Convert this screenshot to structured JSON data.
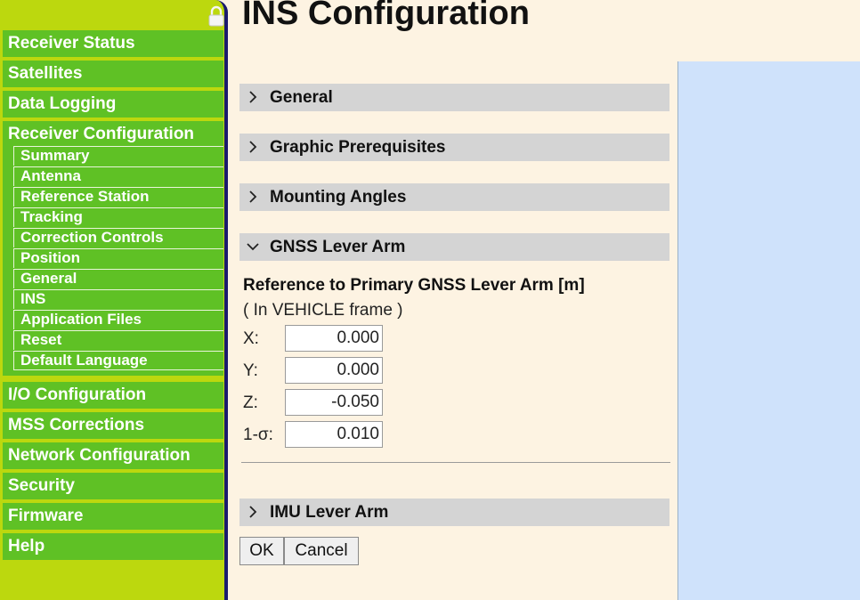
{
  "sidebar": {
    "top_items": [
      "Receiver Status",
      "Satellites",
      "Data Logging"
    ],
    "group_title": "Receiver Configuration",
    "sub_items": [
      "Summary",
      "Antenna",
      "Reference Station",
      "Tracking",
      "Correction Controls",
      "Position",
      "General",
      "INS",
      "Application Files",
      "Reset",
      "Default Language"
    ],
    "bottom_items": [
      "I/O Configuration",
      "MSS Corrections",
      "Network Configuration",
      "Security",
      "Firmware",
      "Help"
    ],
    "active_sub_item": "INS"
  },
  "main": {
    "title": "INS Configuration",
    "sections": [
      {
        "label": "General",
        "expanded": false
      },
      {
        "label": "Graphic Prerequisites",
        "expanded": false
      },
      {
        "label": "Mounting Angles",
        "expanded": false
      },
      {
        "label": "GNSS Lever Arm",
        "expanded": true
      },
      {
        "label": "IMU Lever Arm",
        "expanded": false
      }
    ],
    "gnss_lever_arm": {
      "heading": "Reference to Primary GNSS Lever Arm [m]",
      "frame_note": "( In VEHICLE frame )",
      "fields": [
        {
          "label": "X:",
          "value": "0.000"
        },
        {
          "label": "Y:",
          "value": "0.000"
        },
        {
          "label": "Z:",
          "value": "-0.050"
        },
        {
          "label": "1-σ:",
          "value": "0.010"
        }
      ]
    },
    "buttons": {
      "ok": "OK",
      "cancel": "Cancel"
    }
  },
  "colors": {
    "sidebar_bg": "#bcd80e",
    "nav_green": "#5fc125",
    "page_bg": "#fdf3e2",
    "section_bar": "#d4d4d4",
    "graphic_area": "#cfe2fb"
  },
  "icons": {
    "lock": "lock-icon",
    "collapsed": "chevron-right-icon",
    "expanded": "chevron-down-icon"
  }
}
